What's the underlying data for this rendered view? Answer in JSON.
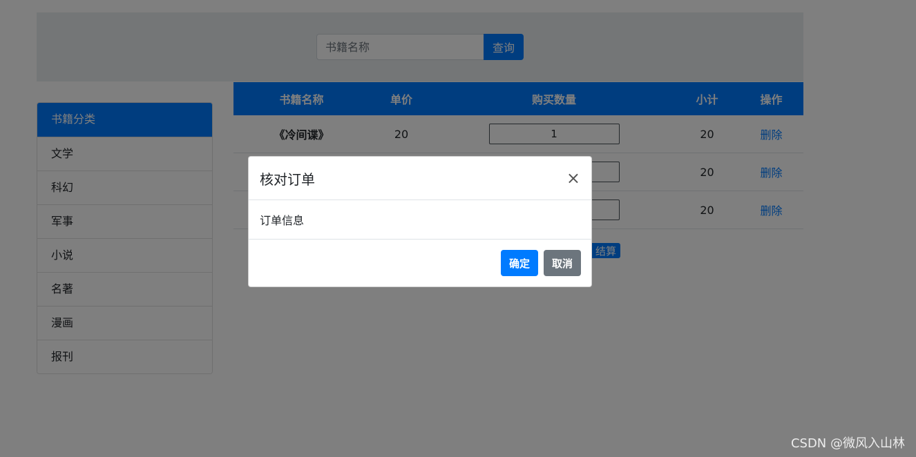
{
  "search": {
    "placeholder": "书籍名称",
    "button_label": "查询"
  },
  "sidebar": {
    "items": [
      {
        "label": "书籍分类"
      },
      {
        "label": "文学"
      },
      {
        "label": "科幻"
      },
      {
        "label": "军事"
      },
      {
        "label": "小说"
      },
      {
        "label": "名著"
      },
      {
        "label": "漫画"
      },
      {
        "label": "报刊"
      }
    ]
  },
  "cart": {
    "headers": {
      "name": "书籍名称",
      "price": "单价",
      "quantity": "购买数量",
      "subtotal": "小计",
      "operation": "操作"
    },
    "rows": [
      {
        "name": "《冷间谍》",
        "price": "20",
        "quantity": "1",
        "subtotal": "20",
        "delete_label": "删除"
      },
      {
        "name": "",
        "price": "",
        "quantity": "",
        "subtotal": "20",
        "delete_label": "删除"
      },
      {
        "name": "",
        "price": "",
        "quantity": "",
        "subtotal": "20",
        "delete_label": "删除"
      }
    ],
    "checkout_label": "结算"
  },
  "modal": {
    "title": "核对订单",
    "close_symbol": "×",
    "body": "订单信息",
    "confirm_label": "确定",
    "cancel_label": "取消"
  },
  "watermark": "CSDN @微风入山林",
  "colors": {
    "primary": "#007bff",
    "secondary": "#6c757d",
    "header_bg": "#e9ecef"
  }
}
